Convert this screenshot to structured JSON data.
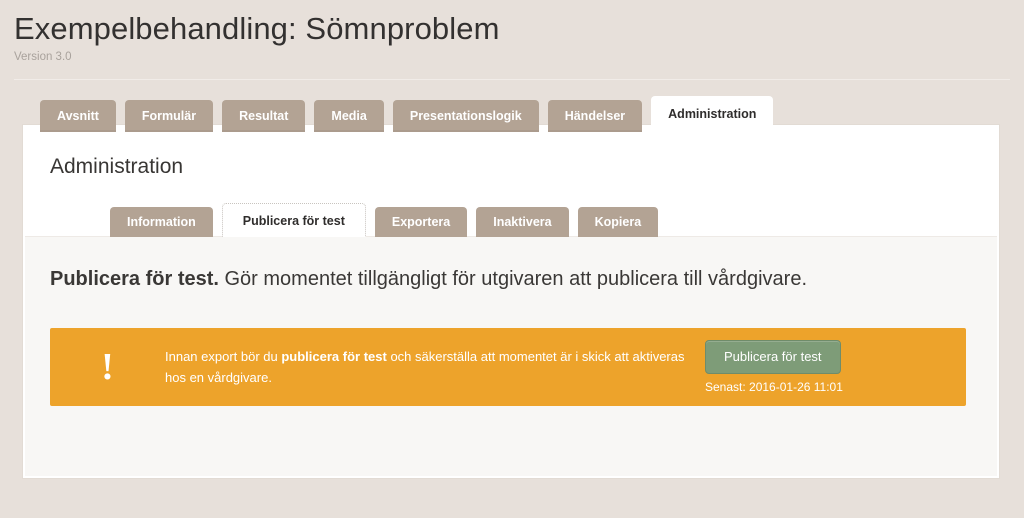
{
  "header": {
    "title": "Exempelbehandling: Sömnproblem",
    "version": "Version 3.0"
  },
  "tabs": [
    {
      "label": "Avsnitt",
      "active": false
    },
    {
      "label": "Formulär",
      "active": false
    },
    {
      "label": "Resultat",
      "active": false
    },
    {
      "label": "Media",
      "active": false
    },
    {
      "label": "Presentationslogik",
      "active": false
    },
    {
      "label": "Händelser",
      "active": false
    },
    {
      "label": "Administration",
      "active": true
    }
  ],
  "card": {
    "title": "Administration"
  },
  "subtabs": [
    {
      "label": "Information",
      "active": false
    },
    {
      "label": "Publicera för test",
      "active": true
    },
    {
      "label": "Exportera",
      "active": false
    },
    {
      "label": "Inaktivera",
      "active": false
    },
    {
      "label": "Kopiera",
      "active": false
    }
  ],
  "lead": {
    "bold": "Publicera för test.",
    "rest": " Gör momentet tillgängligt för utgivaren att publicera till vårdgivare."
  },
  "alert": {
    "icon": "exclamation-icon",
    "icon_glyph": "!",
    "text_part1": "Innan export bör du ",
    "text_bold": "publicera för test",
    "text_part2": " och säkerställa att momentet är i skick att aktiveras hos en vårdgivare.",
    "button_label": "Publicera för test",
    "meta": "Senast: 2016-01-26 11:01"
  },
  "colors": {
    "page_background": "#e7e0da",
    "tab_brown": "#b3a394",
    "alert_orange": "#eda32b",
    "button_green": "#7e9c78",
    "panel_gray": "#f8f7f5",
    "text_dark": "#333130"
  }
}
